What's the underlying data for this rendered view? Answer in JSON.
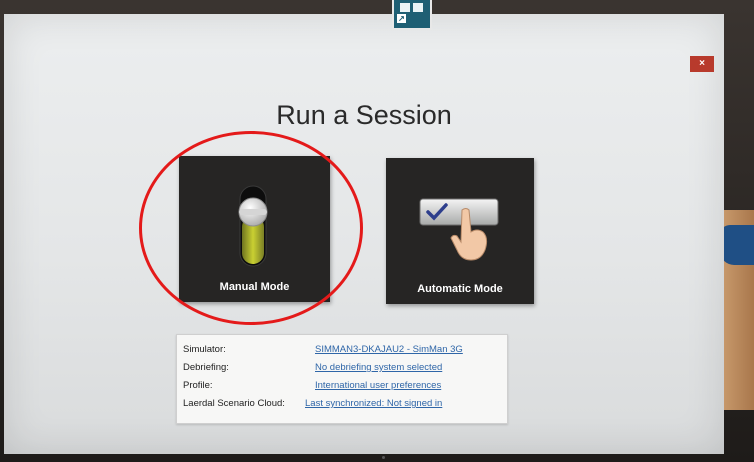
{
  "window": {
    "title": "Run a Session",
    "close_label": "×"
  },
  "modes": [
    {
      "label": "Manual Mode",
      "icon": "slider-toggle-icon"
    },
    {
      "label": "Automatic Mode",
      "icon": "hand-press-checkmark-icon"
    }
  ],
  "info": [
    {
      "key": "Simulator:",
      "value": "SIMMAN3-DKAJAU2 - SimMan 3G"
    },
    {
      "key": "Debriefing:",
      "value": "No debriefing system selected"
    },
    {
      "key": "Profile:",
      "value": "International user preferences"
    },
    {
      "key": "Laerdal Scenario Cloud:",
      "value": "Last synchronized: Not signed in"
    }
  ],
  "colors": {
    "tile_bg": "#262524",
    "close_bg": "#b83a2c",
    "link": "#2f66a8",
    "annotation_ring": "#e41a1a"
  }
}
